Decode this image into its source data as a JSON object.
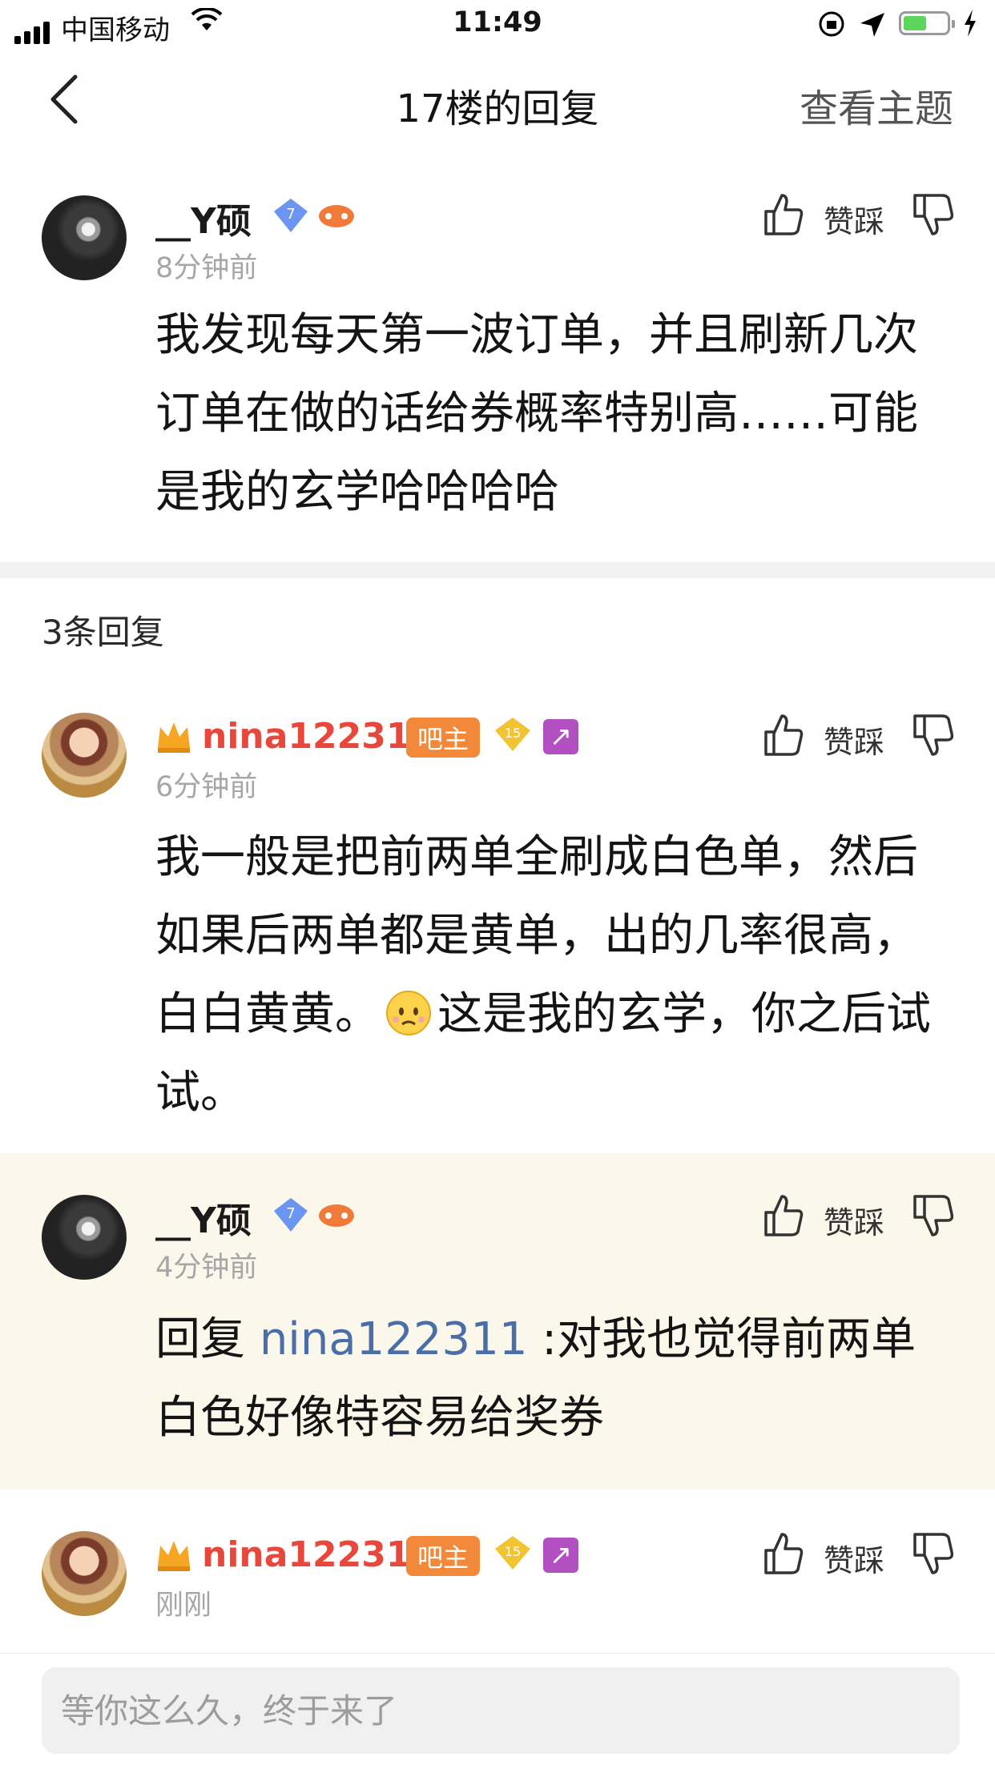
{
  "status_bar": {
    "carrier": "中国移动",
    "time": "11:49"
  },
  "nav": {
    "title": "17楼的回复",
    "view_topic": "查看主题"
  },
  "main_post": {
    "username": "__Y硕",
    "time": "8分钟前",
    "text": "我发现每天第一波订单，并且刷新几次订单在做的话给券概率特别高……可能是我的玄学哈哈哈哈",
    "level": "7",
    "vote_label": "赞踩"
  },
  "reply_count": "3条回复",
  "replies": [
    {
      "username": "nina122311",
      "role": "吧主",
      "level": "15",
      "time": "6分钟前",
      "text": "我一般是把前两单全刷成白色单，然后如果后两单都是黄单，出的几率很高，白白黄黄。",
      "text2": "这是我的玄学，你之后试试。",
      "vote_label": "赞踩"
    },
    {
      "username": "__Y硕",
      "level": "7",
      "time": "4分钟前",
      "reply_prefix": "回复 ",
      "mention": "nina122311",
      "text": " :对我也觉得前两单白色好像特容易给奖券",
      "vote_label": "赞踩"
    },
    {
      "username": "nina122311",
      "role": "吧主",
      "level": "15",
      "time": "刚刚",
      "vote_label": "赞踩"
    }
  ],
  "input": {
    "placeholder": "等你这么久，终于来了"
  },
  "colors": {
    "moderator_name": "#e8473c",
    "mention": "#4a6fa8",
    "highlight_bg": "#fbf7ea",
    "role_badge": "#f2883a"
  },
  "icons": [
    "back-icon",
    "thumb-up-icon",
    "thumb-down-icon",
    "diamond-level-icon",
    "game-icon",
    "crown-icon",
    "sagittarius-icon",
    "wifi-icon",
    "battery-icon"
  ]
}
